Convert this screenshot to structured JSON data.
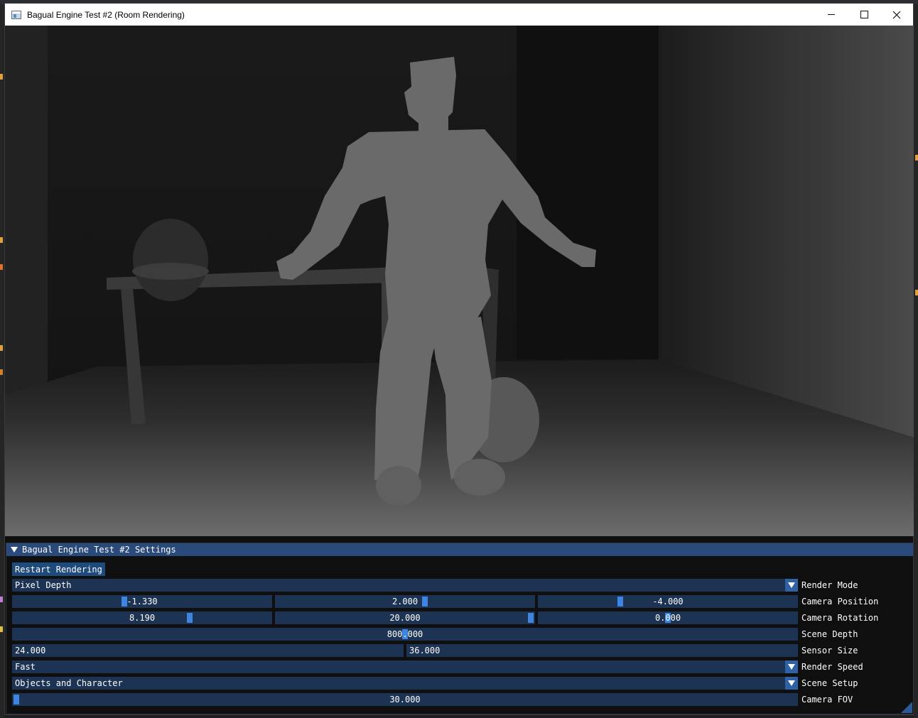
{
  "window": {
    "title": "Bagual Engine Test #2 (Room Rendering)"
  },
  "panel": {
    "title": "Bagual Engine Test #2 Settings",
    "restart_label": "Restart Rendering",
    "render_mode": {
      "value": "Pixel Depth",
      "label": "Render Mode"
    },
    "camera_position": {
      "values": [
        "-1.330",
        "2.000",
        "-4.000"
      ],
      "fractions": [
        0.43,
        0.58,
        0.31
      ],
      "label": "Camera Position"
    },
    "camera_rotation": {
      "values": [
        "8.190",
        "20.000",
        "0.000"
      ],
      "fractions": [
        0.69,
        1.0,
        0.5
      ],
      "label": "Camera Rotation"
    },
    "scene_depth": {
      "value": "800.000",
      "fraction": 0.5,
      "label": "Scene Depth"
    },
    "sensor_size": {
      "values": [
        "24.000",
        "36.000"
      ],
      "label": "Sensor Size"
    },
    "render_speed": {
      "value": "Fast",
      "label": "Render Speed"
    },
    "scene_setup": {
      "value": "Objects and Character",
      "label": "Scene Setup"
    },
    "camera_fov": {
      "value": "30.000",
      "fraction": 0.0,
      "label": "Camera FOV"
    }
  },
  "colors": {
    "header": "#294a7a",
    "frame_bg": "#1c3353",
    "slider_grab": "#3d85e0",
    "button": "#1f4b7c"
  }
}
